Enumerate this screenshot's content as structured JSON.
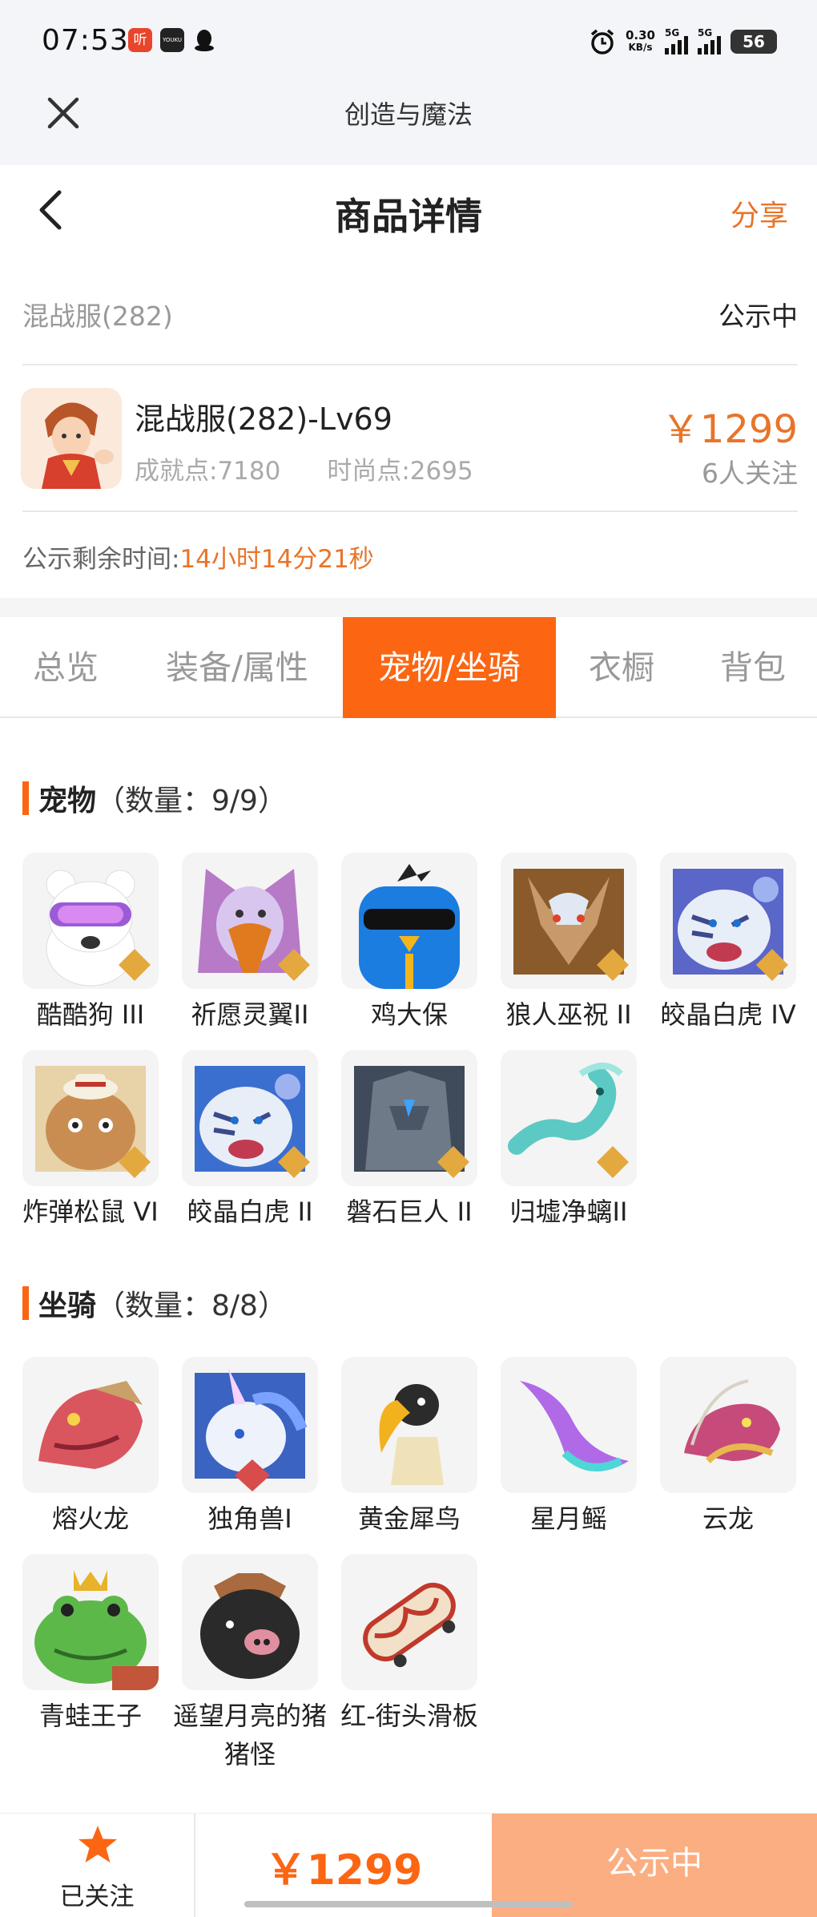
{
  "status_bar": {
    "time": "07:53",
    "speed_value": "0.30",
    "speed_unit": "KB/s",
    "signal1": "5G",
    "signal2": "5G",
    "battery": "56"
  },
  "top_nav": {
    "title": "创造与魔法"
  },
  "header": {
    "title": "商品详情",
    "share": "分享"
  },
  "server": {
    "name": "混战服(282)",
    "status": "公示中"
  },
  "product": {
    "title": "混战服(282)-Lv69",
    "achievement": "成就点:7180",
    "fashion": "时尚点:2695",
    "price": "￥1299",
    "followers": "6人关注"
  },
  "remaining": {
    "label": "公示剩余时间:",
    "time": "14小时14分21秒"
  },
  "tabs": [
    "总览",
    "装备/属性",
    "宠物/坐骑",
    "衣橱",
    "背包"
  ],
  "active_tab": "宠物/坐骑",
  "pets": {
    "title": "宠物",
    "count": "（数量：9/9）",
    "items": [
      {
        "name": "酷酷狗 III",
        "tier": "III"
      },
      {
        "name": "祈愿灵翼II",
        "tier": "II"
      },
      {
        "name": "鸡大保",
        "tier": ""
      },
      {
        "name": "狼人巫祝 II",
        "tier": "II"
      },
      {
        "name": "皎晶白虎 IV",
        "tier": "IV"
      },
      {
        "name": "炸弹松鼠 VI",
        "tier": "VI"
      },
      {
        "name": "皎晶白虎 II",
        "tier": "II"
      },
      {
        "name": "磐石巨人 II",
        "tier": "II"
      },
      {
        "name": "归墟净螭II",
        "tier": "II"
      }
    ]
  },
  "mounts": {
    "title": "坐骑",
    "count": "（数量：8/8）",
    "items": [
      {
        "name": "熔火龙",
        "tier": ""
      },
      {
        "name": "独角兽I",
        "tier": "I"
      },
      {
        "name": "黄金犀鸟",
        "tier": ""
      },
      {
        "name": "星月鳐",
        "tier": ""
      },
      {
        "name": "云龙",
        "tier": ""
      },
      {
        "name": "青蛙王子",
        "tier": ""
      },
      {
        "name": "遥望月亮的猪猪怪",
        "tier": ""
      },
      {
        "name": "红-街头滑板",
        "tier": ""
      }
    ]
  },
  "bottom_bar": {
    "follow_label": "已关注",
    "price": "￥1299",
    "action": "公示中"
  },
  "colors": {
    "accent": "#fc6511",
    "price": "#e8742a",
    "action_bg": "#fbae82"
  }
}
